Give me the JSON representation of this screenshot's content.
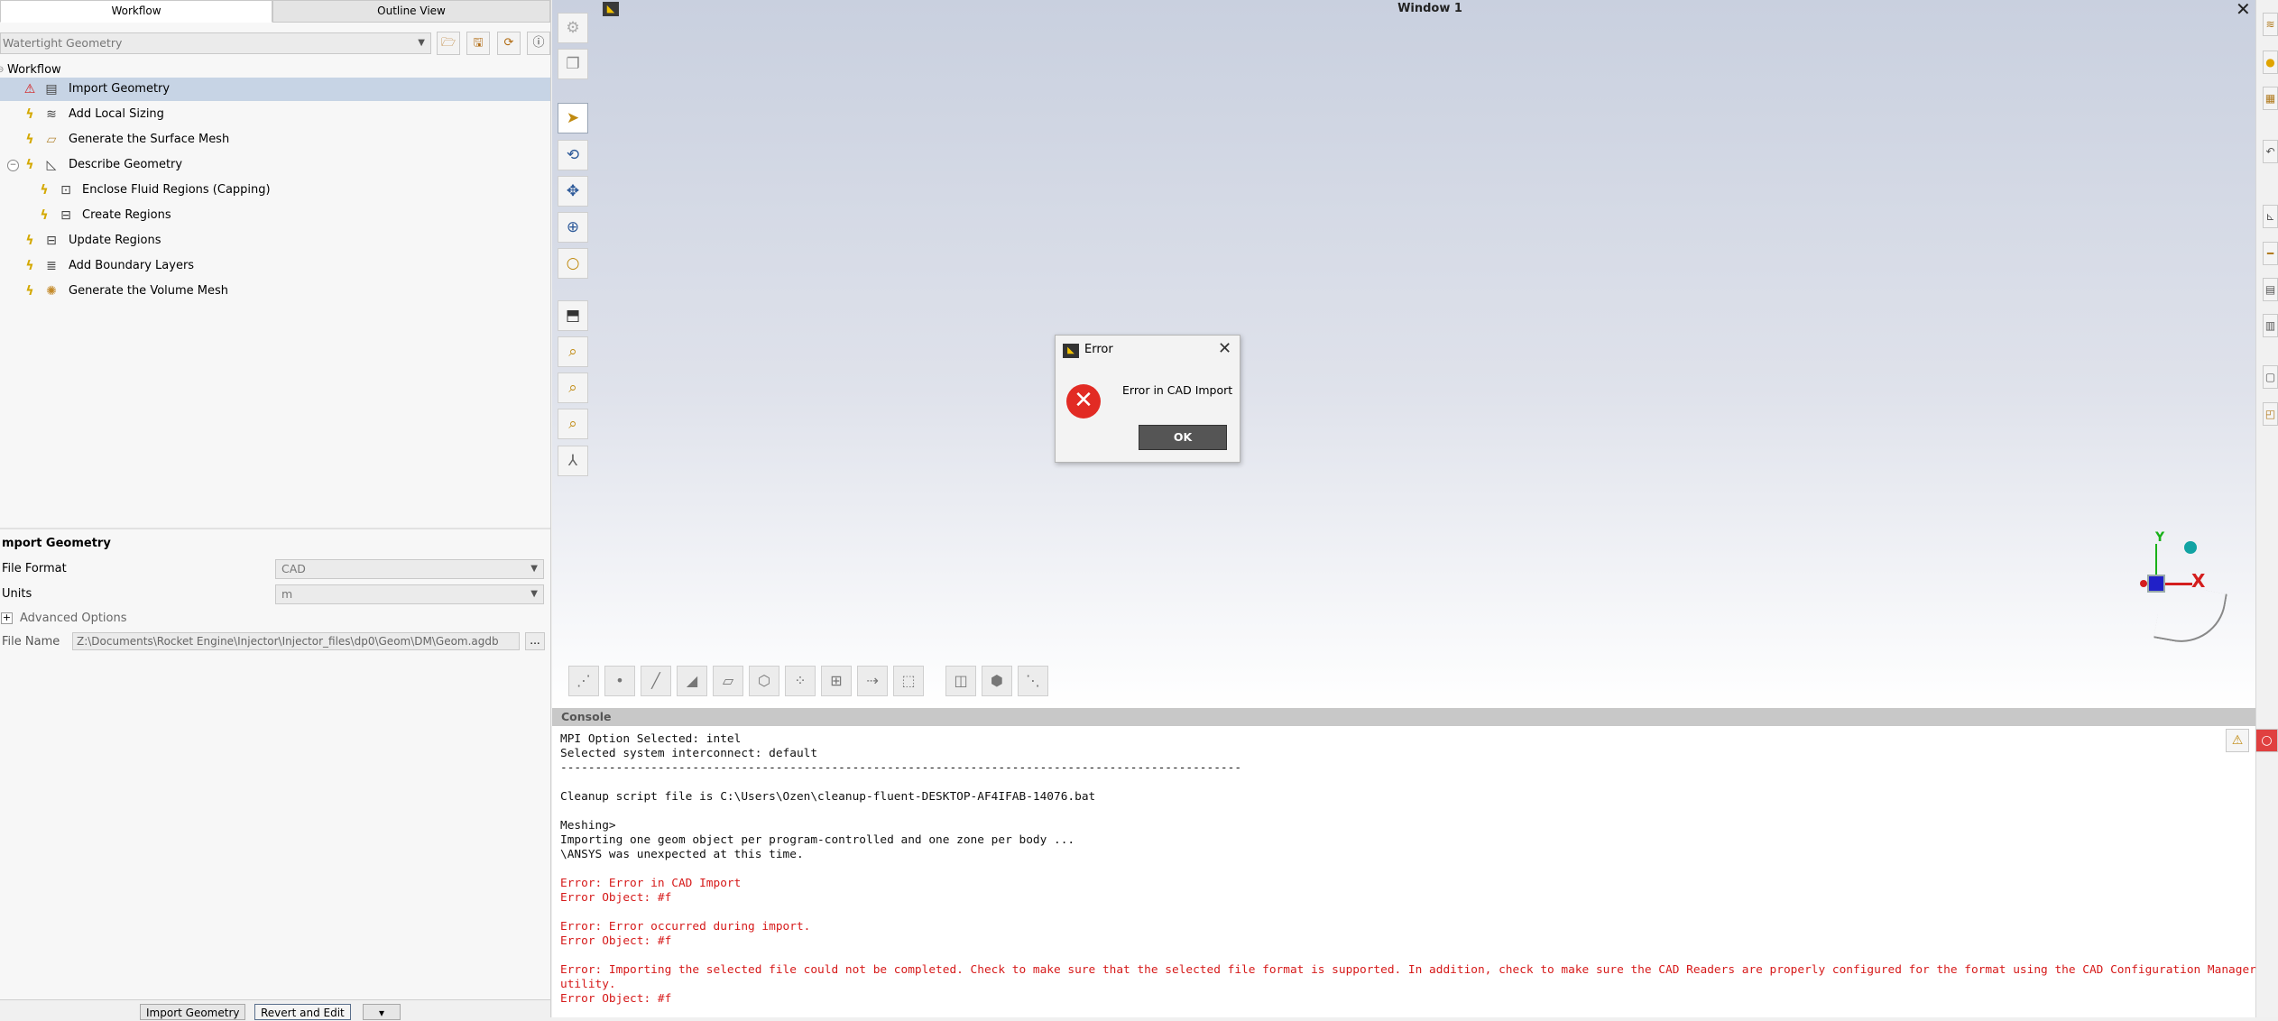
{
  "left_panel": {
    "tabs": [
      "Workflow",
      "Outline View"
    ],
    "workflow_type": "Watertight Geometry",
    "tree_root": "Workflow",
    "tasks": [
      {
        "label": "Import Geometry",
        "status": "warning"
      },
      {
        "label": "Add Local Sizing",
        "status": "pending"
      },
      {
        "label": "Generate the Surface Mesh",
        "status": "pending"
      },
      {
        "label": "Describe Geometry",
        "status": "pending"
      },
      {
        "label": "Enclose Fluid Regions (Capping)",
        "status": "pending"
      },
      {
        "label": "Create Regions",
        "status": "pending"
      },
      {
        "label": "Update Regions",
        "status": "pending"
      },
      {
        "label": "Add Boundary Layers",
        "status": "pending"
      },
      {
        "label": "Generate the Volume Mesh",
        "status": "pending"
      }
    ],
    "properties": {
      "title": "mport Geometry",
      "file_format_label": "File Format",
      "file_format_value": "CAD",
      "units_label": "Units",
      "units_value": "m",
      "advanced_options_label": "Advanced Options",
      "file_name_label": "File Name",
      "file_name_value": "Z:\\Documents\\Rocket Engine\\Injector\\Injector_files\\dp0\\Geom\\DM\\Geom.agdb",
      "browse_label": "..."
    },
    "buttons": {
      "import": "Import Geometry",
      "revert": "Revert and Edit"
    }
  },
  "graphics": {
    "window_title": "Window 1",
    "close_glyph": "✕",
    "triad": {
      "y_label": "Y",
      "x_label": "X"
    }
  },
  "dialog": {
    "title": "Error",
    "message": "Error in CAD Import",
    "ok_label": "OK",
    "close_glyph": "✕",
    "icon": "error-x-icon",
    "icon_color": "#e22b24"
  },
  "console": {
    "title": "Console",
    "lines": [
      {
        "text": "MPI Option Selected: intel",
        "type": "normal"
      },
      {
        "text": "Selected system interconnect: default",
        "type": "normal"
      },
      {
        "text": "--------------------------------------------------------------------------------------------------",
        "type": "normal"
      },
      {
        "text": "",
        "type": "normal"
      },
      {
        "text": "Cleanup script file is C:\\Users\\Ozen\\cleanup-fluent-DESKTOP-AF4IFAB-14076.bat",
        "type": "normal"
      },
      {
        "text": "",
        "type": "normal"
      },
      {
        "text": "Meshing>",
        "type": "normal"
      },
      {
        "text": "Importing one geom object per program-controlled and one zone per body ...",
        "type": "normal"
      },
      {
        "text": "\\ANSYS was unexpected at this time.",
        "type": "normal"
      },
      {
        "text": "",
        "type": "normal"
      },
      {
        "text": "Error: Error in CAD Import",
        "type": "error"
      },
      {
        "text": "Error Object: #f",
        "type": "error"
      },
      {
        "text": "",
        "type": "normal"
      },
      {
        "text": "Error: Error occurred during import.",
        "type": "error"
      },
      {
        "text": "Error Object: #f",
        "type": "error"
      },
      {
        "text": "",
        "type": "normal"
      },
      {
        "text": "Error: Importing the selected file could not be completed. Check to make sure that the selected file format is supported. In addition, check to make sure the CAD Readers are properly configured for the format using the CAD Configuration Manager utility.",
        "type": "error"
      },
      {
        "text": "Error Object: #f",
        "type": "error"
      }
    ]
  },
  "colors": {
    "selection": "#c7d4e5",
    "error_text": "#d61a1a",
    "warning_icon": "#d41b1b",
    "pending_icon": "#d4a800"
  }
}
